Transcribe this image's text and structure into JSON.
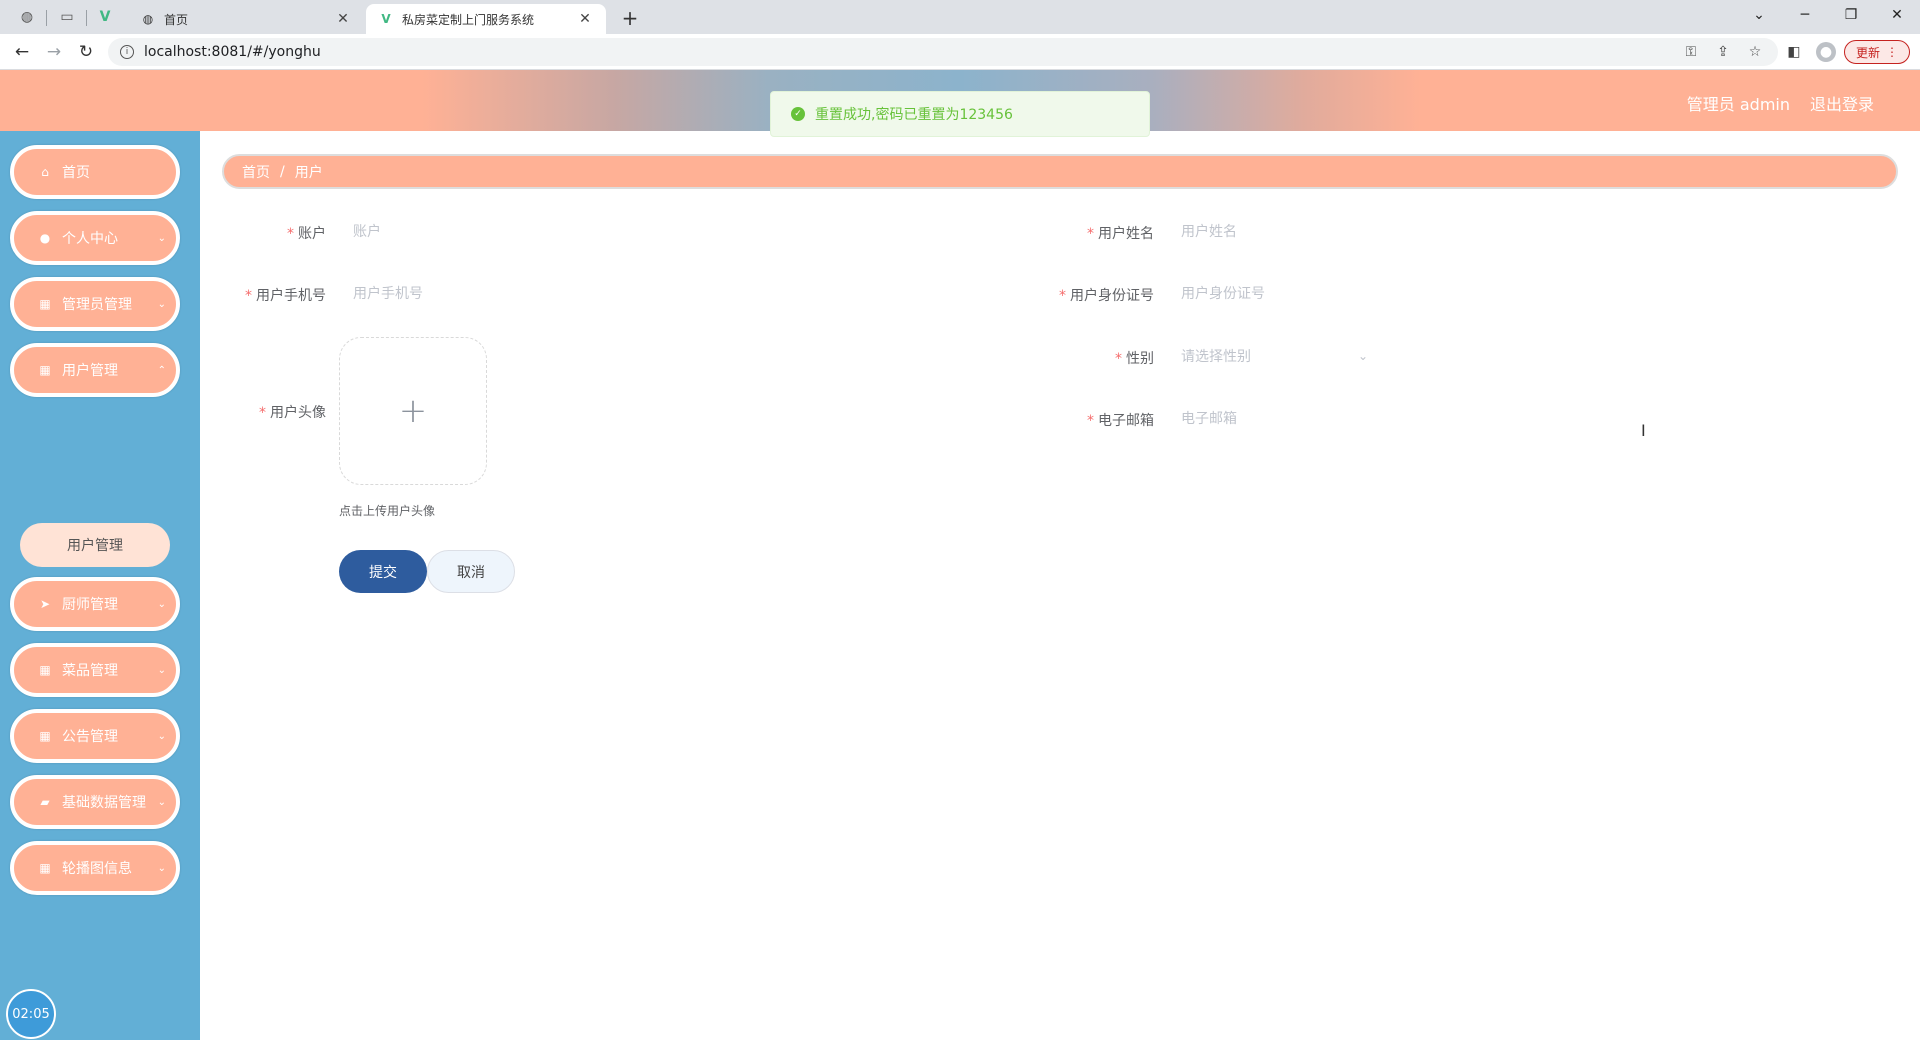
{
  "browser": {
    "tabs": [
      {
        "label": "首页",
        "icon": "globe-icon"
      },
      {
        "label": "私房菜定制上门服务系统",
        "icon": "vue-logo-icon"
      }
    ],
    "url": "localhost:8081/#/yonghu",
    "update_label": "更新"
  },
  "header": {
    "user": "管理员 admin",
    "logout": "退出登录"
  },
  "toast": {
    "message": "重置成功,密码已重置为123456",
    "color": "#67c23a"
  },
  "sidebar": {
    "items": [
      {
        "label": "首页",
        "icon": "home-icon"
      },
      {
        "label": "个人中心",
        "icon": "user-icon"
      },
      {
        "label": "管理员管理",
        "icon": "grid-icon"
      },
      {
        "label": "用户管理",
        "icon": "grid-icon"
      },
      {
        "label": "厨师管理",
        "icon": "send-icon"
      },
      {
        "label": "菜品管理",
        "icon": "grid-icon"
      },
      {
        "label": "公告管理",
        "icon": "grid-icon"
      },
      {
        "label": "基础数据管理",
        "icon": "shopping-bag-icon"
      },
      {
        "label": "轮播图信息",
        "icon": "grid-icon"
      }
    ],
    "sub_item": "用户管理",
    "clock": "02:05"
  },
  "breadcrumb": {
    "home": "首页",
    "separator": "/",
    "current": "用户"
  },
  "form": {
    "account": {
      "label": "账户",
      "placeholder": "账户"
    },
    "name": {
      "label": "用户姓名",
      "placeholder": "用户姓名"
    },
    "phone": {
      "label": "用户手机号",
      "placeholder": "用户手机号"
    },
    "idcard": {
      "label": "用户身份证号",
      "placeholder": "用户身份证号"
    },
    "avatar": {
      "label": "用户头像",
      "tip": "点击上传用户头像"
    },
    "gender": {
      "label": "性别",
      "placeholder": "请选择性别"
    },
    "email": {
      "label": "电子邮箱",
      "placeholder": "电子邮箱"
    },
    "required_mark": "*",
    "submit": "提交",
    "cancel": "取消"
  },
  "colors": {
    "accent": "#ffb195",
    "sidebar_bg": "#62afd6",
    "submit_bg": "#2e5c9e"
  }
}
